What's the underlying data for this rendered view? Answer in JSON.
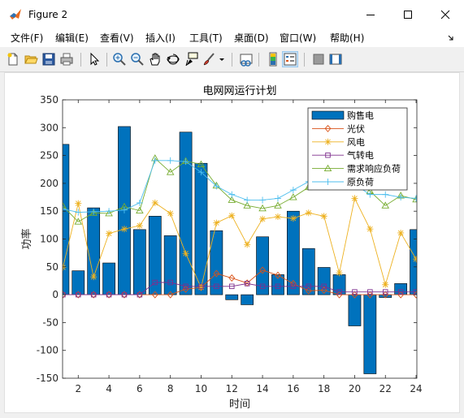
{
  "window": {
    "title": "Figure 2",
    "minimize_icon": "minimize-icon",
    "maximize_icon": "maximize-icon",
    "close_icon": "close-icon"
  },
  "menu": [
    "文件(F)",
    "编辑(E)",
    "查看(V)",
    "插入(I)",
    "工具(T)",
    "桌面(D)",
    "窗口(W)",
    "帮助(H)"
  ],
  "toolbar": [
    "new-figure-icon",
    "open-file-icon",
    "save-icon",
    "print-icon",
    "edit-plot-icon",
    "zoom-in-icon",
    "zoom-out-icon",
    "pan-icon",
    "rotate-3d-icon",
    "data-cursor-icon",
    "brush-icon",
    "brush-dropdown-icon",
    "link-plot-icon",
    "insert-colorbar-icon",
    "insert-legend-icon",
    "hide-plot-tools-icon",
    "show-plot-tools-icon"
  ],
  "colors": {
    "bar": "#0072bd",
    "pv": "#d95319",
    "wind": "#edb120",
    "gas": "#7e2f8e",
    "demand": "#77ac30",
    "load": "#4dbeee"
  },
  "chart_data": {
    "type": "bar",
    "title": "电网网运行计划",
    "xlabel": "时间",
    "ylabel": "功率",
    "xlim": [
      1,
      24
    ],
    "ylim": [
      -150,
      350
    ],
    "xticks": [
      2,
      4,
      6,
      8,
      10,
      12,
      14,
      16,
      18,
      20,
      22,
      24
    ],
    "yticks": [
      -150,
      -100,
      -50,
      0,
      50,
      100,
      150,
      200,
      250,
      300,
      350
    ],
    "x": [
      1,
      2,
      3,
      4,
      5,
      6,
      7,
      8,
      9,
      10,
      11,
      12,
      13,
      14,
      15,
      16,
      17,
      18,
      19,
      20,
      21,
      22,
      23,
      24
    ],
    "legend_position": "top-right",
    "series": [
      {
        "name": "购售电",
        "kind": "bar",
        "values": [
          270,
          43,
          156,
          57,
          302,
          117,
          141,
          106,
          292,
          236,
          115,
          -9,
          -18,
          104,
          36,
          150,
          83,
          49,
          36,
          -56,
          -142,
          -5,
          20,
          117
        ]
      },
      {
        "name": "光伏",
        "kind": "line",
        "marker": "diamond",
        "values": [
          0,
          0,
          0,
          0,
          0,
          0,
          0,
          0,
          10,
          13,
          38,
          30,
          21,
          44,
          35,
          20,
          7,
          8,
          0,
          0,
          0,
          0,
          0,
          0
        ]
      },
      {
        "name": "风电",
        "kind": "line",
        "marker": "star",
        "values": [
          49,
          164,
          32,
          110,
          118,
          124,
          165,
          146,
          74,
          13,
          129,
          142,
          90,
          136,
          140,
          137,
          147,
          141,
          39,
          173,
          118,
          18,
          111,
          64
        ]
      },
      {
        "name": "气转电",
        "kind": "line",
        "marker": "square",
        "values": [
          0,
          0,
          0,
          0,
          0,
          0,
          22,
          22,
          15,
          15,
          15,
          15,
          20,
          15,
          15,
          15,
          15,
          15,
          5,
          5,
          5,
          5,
          5,
          5
        ]
      },
      {
        "name": "需求响应负荷",
        "kind": "line",
        "marker": "triangle",
        "values": [
          159,
          131,
          147,
          146,
          158,
          151,
          245,
          220,
          240,
          234,
          196,
          170,
          160,
          155,
          160,
          175,
          193,
          205,
          220,
          212,
          186,
          160,
          178,
          171
        ]
      },
      {
        "name": "原负荷",
        "kind": "line",
        "marker": "plus",
        "values": [
          154,
          148,
          149,
          150,
          152,
          165,
          241,
          241,
          239,
          220,
          195,
          180,
          170,
          170,
          173,
          188,
          203,
          213,
          210,
          198,
          180,
          180,
          175,
          173
        ]
      }
    ]
  }
}
